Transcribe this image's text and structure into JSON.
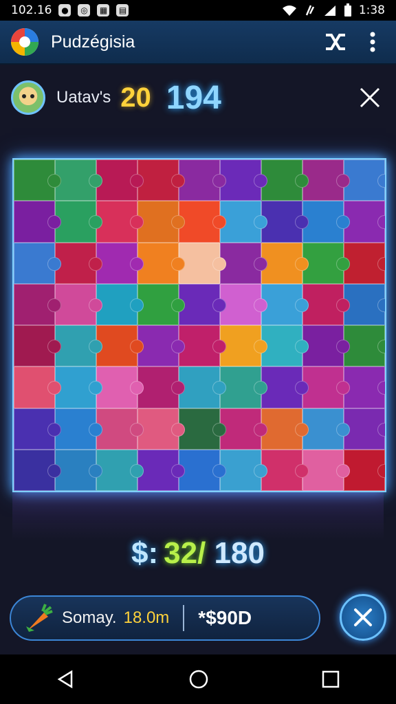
{
  "status_bar": {
    "time_left": "102.16",
    "time_right": "1:38"
  },
  "app": {
    "title": "Pudzégisia"
  },
  "header": {
    "player_name": "Uatav's",
    "level": "20",
    "score": "194"
  },
  "progress": {
    "prefix": "$:",
    "placed": "32/",
    "total": "180"
  },
  "hint_panel": {
    "label": "Somay.",
    "time": "18.0m",
    "coins": "*$90D"
  },
  "colors": {
    "accent": "#2aa6ff",
    "level_yellow": "#ffd23b",
    "progress_green": "#b8f04a"
  },
  "icons": {
    "app_logo": "app-logo-icon",
    "shuffle": "shuffle-icon",
    "menu": "more-vert-icon",
    "close": "close-icon",
    "hint": "carrot-icon"
  },
  "puzzle": {
    "columns": 9,
    "rows": 8,
    "pieces": [
      "#2e8b3a",
      "#33a06a",
      "#b81a55",
      "#c02040",
      "#8a2aa0",
      "#6b2ab8",
      "#2e8b3a",
      "#9a2a8a",
      "#3a7ad0",
      "#7a1fa0",
      "#2aa060",
      "#d8305a",
      "#e07020",
      "#f04a28",
      "#3aa0d8",
      "#4a30b0",
      "#2a80d0",
      "#8a2ab0",
      "#3a7ad0",
      "#c0204a",
      "#a02ab0",
      "#f08020",
      "#f5c0a0",
      "#8a2aa0",
      "#f09020",
      "#33a040",
      "#c02030",
      "#a02070",
      "#d04a9a",
      "#20a0c0",
      "#30a040",
      "#6a2ab8",
      "#d060d0",
      "#3aa0d8",
      "#c02060",
      "#2a70c0",
      "#a01a50",
      "#30a0b0",
      "#e04a20",
      "#8a2ab0",
      "#c0206a",
      "#f0a020",
      "#30b0c0",
      "#7a20a0",
      "#2e8b3a",
      "#e05070",
      "#30a0d0",
      "#e060b0",
      "#b02070",
      "#30a0c0",
      "#30a090",
      "#6a2ab8",
      "#c03090",
      "#8a2ab0",
      "#4a30b0",
      "#2a80d0",
      "#d04a80",
      "#e05a80",
      "#2a6a40",
      "#c02a7a",
      "#e06a30",
      "#3a90d0",
      "#7a2ab0",
      "#3a30a0",
      "#2a80c0",
      "#30a0b0",
      "#6a2ab8",
      "#2a70d0",
      "#3aa0d0",
      "#d0306a",
      "#e060a0",
      "#c01a30"
    ]
  }
}
